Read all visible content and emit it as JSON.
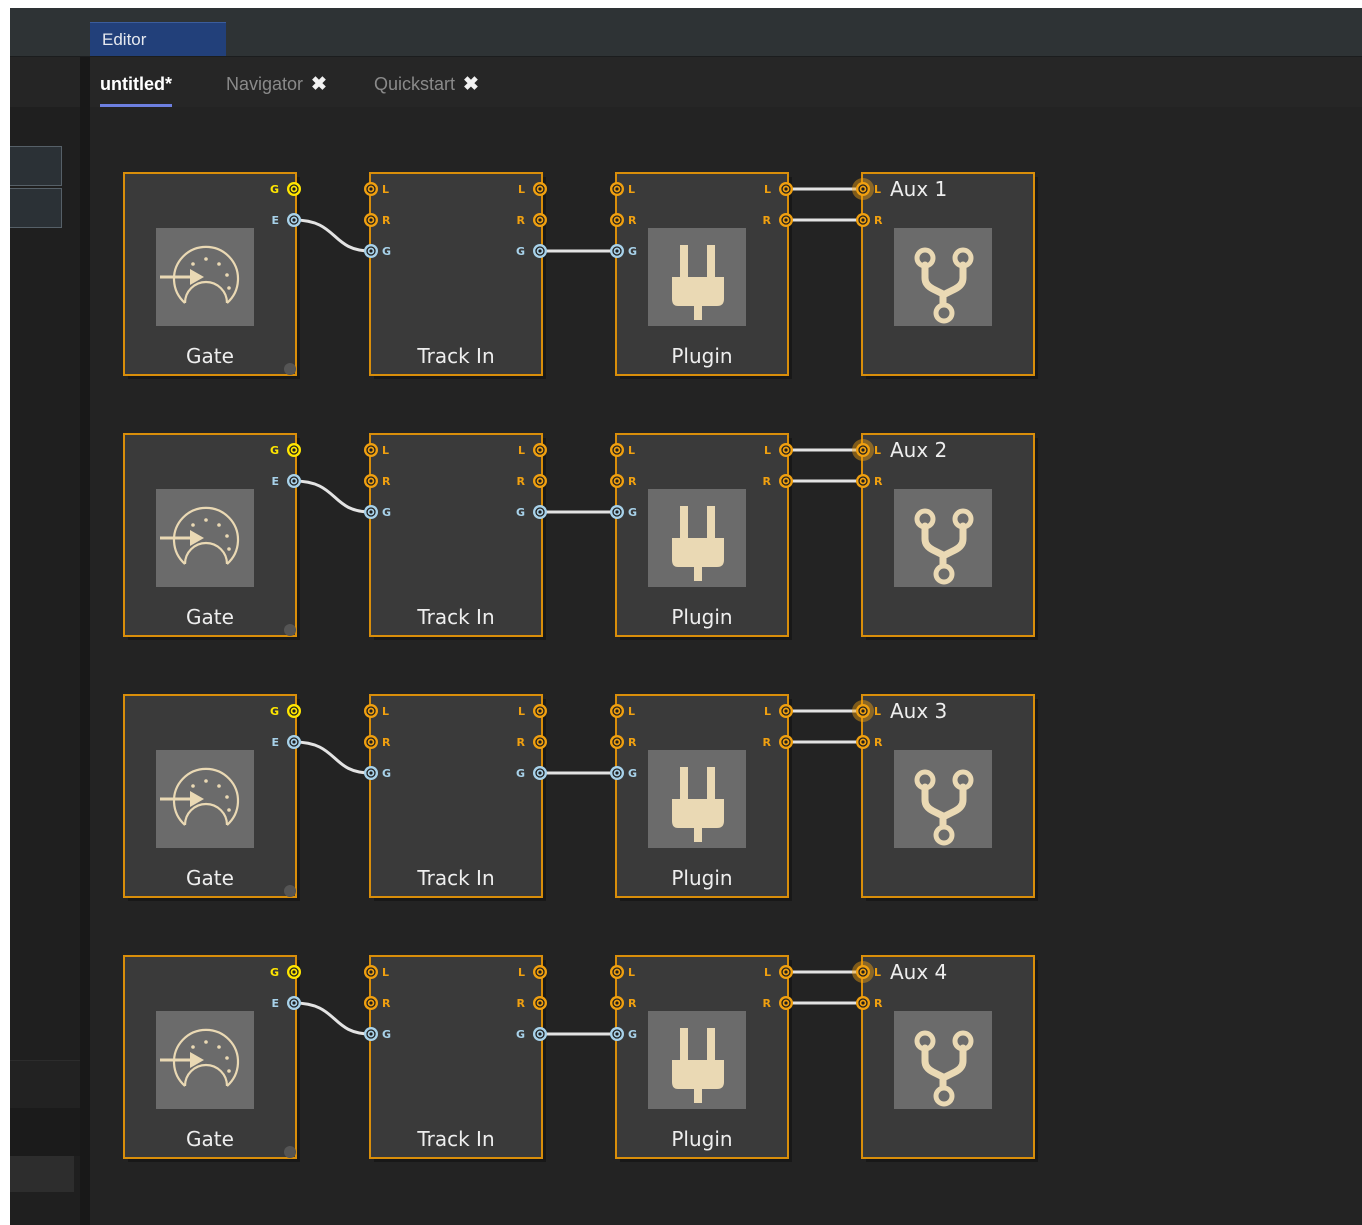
{
  "header": {
    "editor_tab": "Editor"
  },
  "tabs": [
    {
      "label": "untitled*",
      "active": true
    },
    {
      "label": "Navigator",
      "active": false,
      "close_icon": "close-icon"
    },
    {
      "label": "Quickstart",
      "active": false,
      "close_icon": "close-icon"
    }
  ],
  "colors": {
    "node_border": "#d98e0a",
    "node_fill": "#3a3a3a",
    "icon_tile": "#6b6b6b",
    "icon_color": "#ead9b4",
    "port_orange": "#f0a010",
    "port_yellow": "#ffe600",
    "port_blue": "#a8d2ea",
    "wire": "#e3e3e3",
    "canvas": "#232323"
  },
  "ports": {
    "gate_g": "G",
    "gate_e": "E",
    "left": "L",
    "right": "R",
    "gate": "G"
  },
  "rows": [
    {
      "gate": "Gate",
      "track": "Track In",
      "plugin": "Plugin",
      "aux": "Aux 1"
    },
    {
      "gate": "Gate",
      "track": "Track In",
      "plugin": "Plugin",
      "aux": "Aux 2"
    },
    {
      "gate": "Gate",
      "track": "Track In",
      "plugin": "Plugin",
      "aux": "Aux 3"
    },
    {
      "gate": "Gate",
      "track": "Track In",
      "plugin": "Plugin",
      "aux": "Aux 4"
    }
  ],
  "icons": {
    "gate": "midi-gate-icon",
    "plugin": "plug-icon",
    "aux": "aux-split-icon"
  }
}
